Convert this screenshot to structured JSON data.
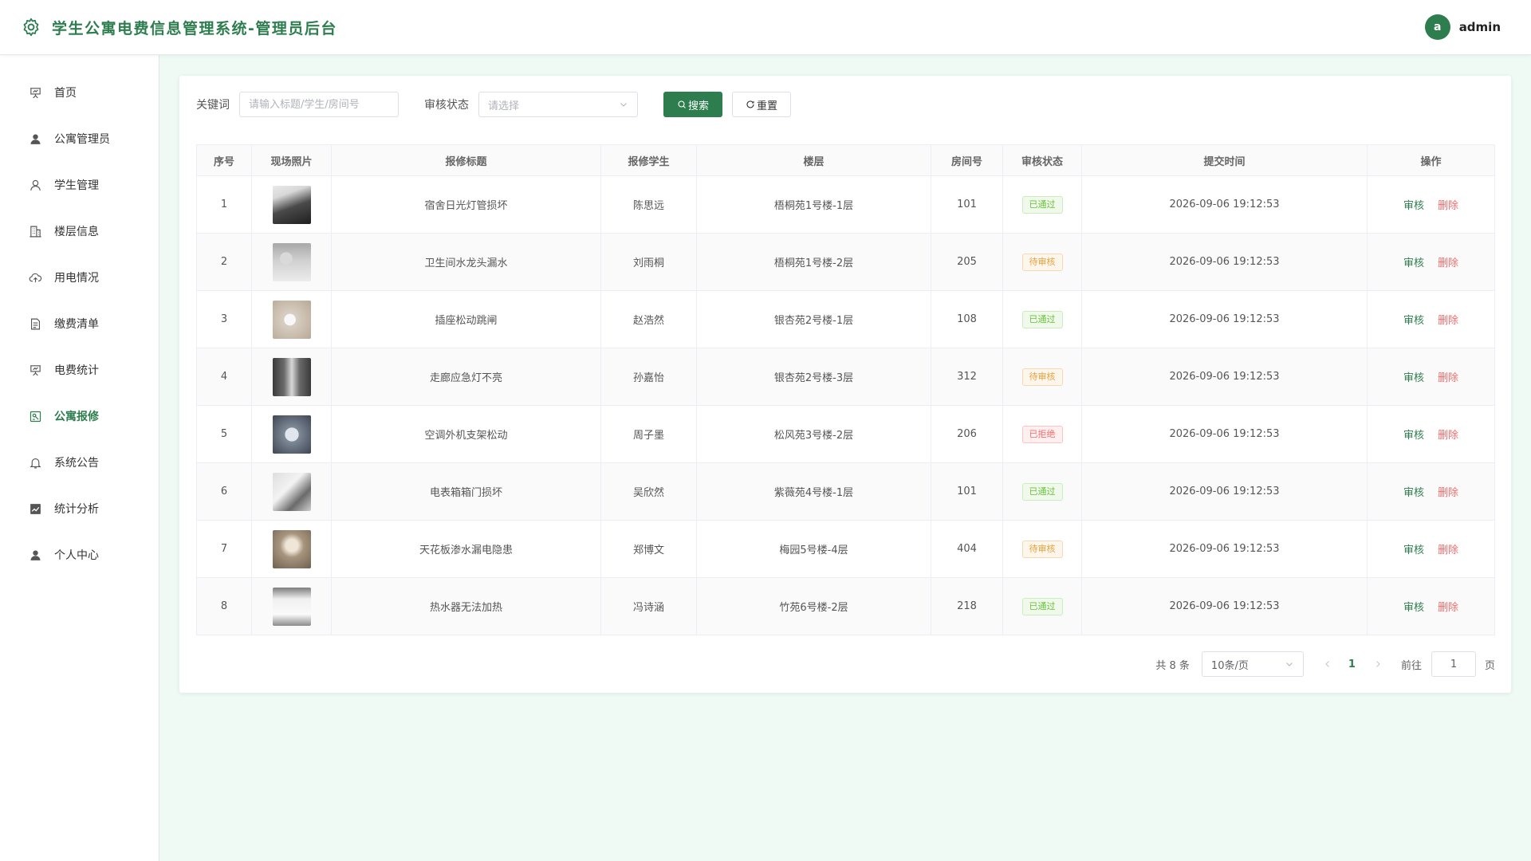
{
  "header": {
    "title": "学生公寓电费信息管理系统-管理员后台",
    "avatar_letter": "a",
    "username": "admin"
  },
  "sidebar": {
    "items": [
      {
        "label": "首页",
        "icon": "presentation-icon"
      },
      {
        "label": "公寓管理员",
        "icon": "user-filled-icon"
      },
      {
        "label": "学生管理",
        "icon": "user-outline-icon"
      },
      {
        "label": "楼层信息",
        "icon": "building-icon"
      },
      {
        "label": "用电情况",
        "icon": "cloud-upload-icon"
      },
      {
        "label": "缴费清单",
        "icon": "document-icon"
      },
      {
        "label": "电费统计",
        "icon": "presentation-icon"
      },
      {
        "label": "公寓报修",
        "icon": "repair-icon",
        "active": true
      },
      {
        "label": "系统公告",
        "icon": "bell-icon"
      },
      {
        "label": "统计分析",
        "icon": "chart-icon"
      },
      {
        "label": "个人中心",
        "icon": "user-filled-icon"
      }
    ]
  },
  "filter": {
    "keyword_label": "关键词",
    "keyword_placeholder": "请输入标题/学生/房间号",
    "status_label": "审核状态",
    "status_placeholder": "请选择",
    "search_label": "搜索",
    "reset_label": "重置"
  },
  "table": {
    "headers": [
      "序号",
      "现场照片",
      "报修标题",
      "报修学生",
      "楼层",
      "房间号",
      "审核状态",
      "提交时间",
      "操作"
    ],
    "rows": [
      {
        "no": "1",
        "title": "宿舍日光灯管损坏",
        "student": "陈思远",
        "floor": "梧桐苑1号楼-1层",
        "room": "101",
        "status": "已通过",
        "status_type": "approved",
        "time": "2026-09-06 19:12:53",
        "photo": "dark"
      },
      {
        "no": "2",
        "title": "卫生间水龙头漏水",
        "student": "刘雨桐",
        "floor": "梧桐苑1号楼-2层",
        "room": "205",
        "status": "待审核",
        "status_type": "pending",
        "time": "2026-09-06 19:12:53",
        "photo": "faucet"
      },
      {
        "no": "3",
        "title": "插座松动跳闸",
        "student": "赵浩然",
        "floor": "银杏苑2号楼-1层",
        "room": "108",
        "status": "已通过",
        "status_type": "approved",
        "time": "2026-09-06 19:12:53",
        "photo": "socket"
      },
      {
        "no": "4",
        "title": "走廊应急灯不亮",
        "student": "孙嘉怡",
        "floor": "银杏苑2号楼-3层",
        "room": "312",
        "status": "待审核",
        "status_type": "pending",
        "time": "2026-09-06 19:12:53",
        "photo": "corridor"
      },
      {
        "no": "5",
        "title": "空调外机支架松动",
        "student": "周子墨",
        "floor": "松风苑3号楼-2层",
        "room": "206",
        "status": "已拒绝",
        "status_type": "rejected",
        "time": "2026-09-06 19:12:53",
        "photo": "ac"
      },
      {
        "no": "6",
        "title": "电表箱箱门损坏",
        "student": "吴欣然",
        "floor": "紫薇苑4号楼-1层",
        "room": "101",
        "status": "已通过",
        "status_type": "approved",
        "time": "2026-09-06 19:12:53",
        "photo": "meter"
      },
      {
        "no": "7",
        "title": "天花板渗水漏电隐患",
        "student": "郑博文",
        "floor": "梅园5号楼-4层",
        "room": "404",
        "status": "待审核",
        "status_type": "pending",
        "time": "2026-09-06 19:12:53",
        "photo": "ceiling"
      },
      {
        "no": "8",
        "title": "热水器无法加热",
        "student": "冯诗涵",
        "floor": "竹苑6号楼-2层",
        "room": "218",
        "status": "已通过",
        "status_type": "approved",
        "time": "2026-09-06 19:12:53",
        "photo": "heater"
      }
    ],
    "op_review": "审核",
    "op_delete": "删除"
  },
  "pagination": {
    "total_label": "共 8 条",
    "page_size": "10条/页",
    "current_page": "1",
    "goto_label": "前往",
    "goto_value": "1",
    "page_unit": "页"
  },
  "colors": {
    "primary": "#2e7d4f",
    "danger": "#f56c6c",
    "page_bg": "#eefaf3"
  }
}
